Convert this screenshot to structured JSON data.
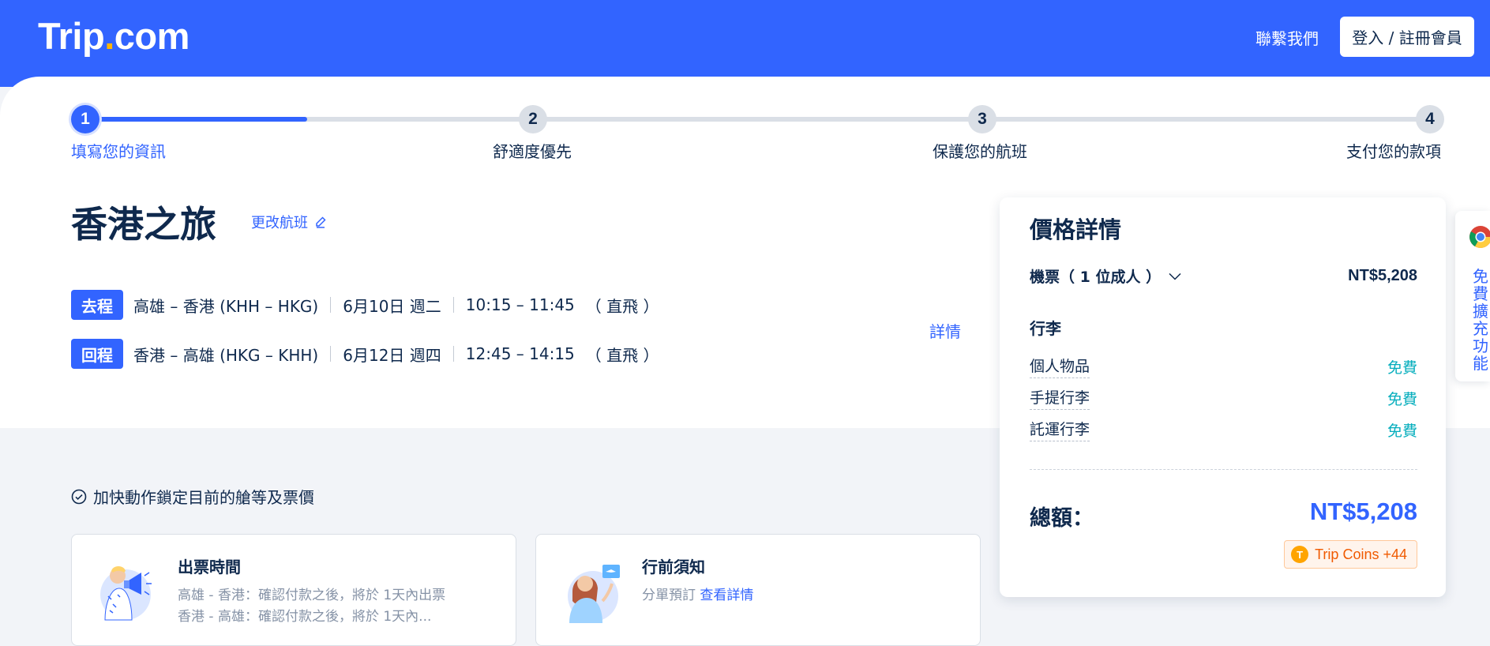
{
  "header": {
    "logo_main": "Trip",
    "logo_dot": ".",
    "logo_tail": "com",
    "contact": "聯繫我們",
    "login": "登入 / 註冊會員"
  },
  "steps": [
    {
      "num": "1",
      "label": "填寫您的資訊"
    },
    {
      "num": "2",
      "label": "舒適度優先"
    },
    {
      "num": "3",
      "label": "保護您的航班"
    },
    {
      "num": "4",
      "label": "支付您的款項"
    }
  ],
  "trip": {
    "title": "香港之旅",
    "change_flight": "更改航班",
    "details": "詳情",
    "legs": [
      {
        "badge": "去程",
        "route": "高雄 – 香港 (KHH – HKG)",
        "date": "6月10日 週二",
        "time": "10:15 – 11:45",
        "type": "（ 直飛 ）"
      },
      {
        "badge": "回程",
        "route": "香港 – 高雄 (HKG – KHH)",
        "date": "6月12日 週四",
        "time": "12:45 – 14:15",
        "type": "（ 直飛 ）"
      }
    ]
  },
  "price": {
    "title": "價格詳情",
    "ticket_label": "機票（ 1 位成人 ）",
    "ticket_price": "NT$5,208",
    "baggage_title": "行李",
    "baggage": [
      {
        "name": "個人物品",
        "value": "免費"
      },
      {
        "name": "手提行李",
        "value": "免費"
      },
      {
        "name": "託運行李",
        "value": "免費"
      }
    ],
    "total_label": "總額：",
    "total_value": "NT$5,208",
    "coins": "Trip Coins +44",
    "coin_glyph": "T"
  },
  "extension": {
    "text": "免費擴充功能"
  },
  "lock_text": "加快動作鎖定目前的艙等及票價",
  "cards": {
    "ticketing": {
      "title": "出票時間",
      "line1": "高雄 - 香港：確認付款之後，將於 1天內出票",
      "line2": "香港 - 高雄：確認付款之後，將於 1天內..."
    },
    "notice": {
      "title": "行前須知",
      "line1": "分單預訂",
      "link": "查看詳情"
    }
  },
  "colors": {
    "brand_blue": "#3264ff",
    "free_teal": "#06aebd",
    "coins_orange": "#f05a00"
  }
}
